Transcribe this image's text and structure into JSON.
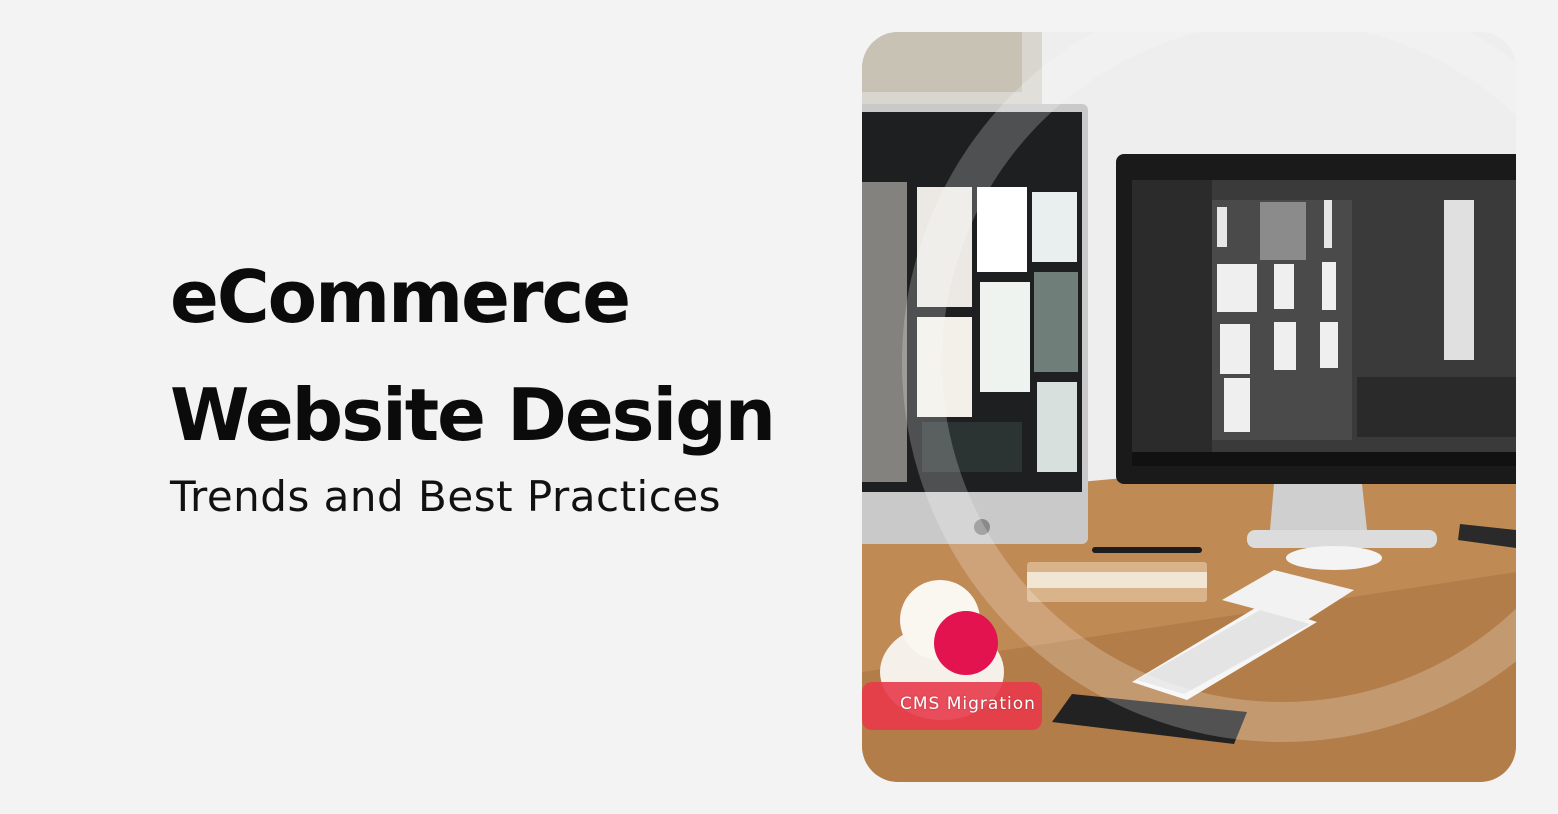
{
  "headline": {
    "line1": "eCommerce",
    "line2": "Website Design"
  },
  "subtitle": "Trends and Best Practices",
  "photo": {
    "description_icon": "desktop-workspace-photo",
    "caption": "CMS Migration"
  },
  "colors": {
    "background": "#f3f3f3",
    "accent": "#e2134f",
    "text": "#0b0b0b"
  }
}
